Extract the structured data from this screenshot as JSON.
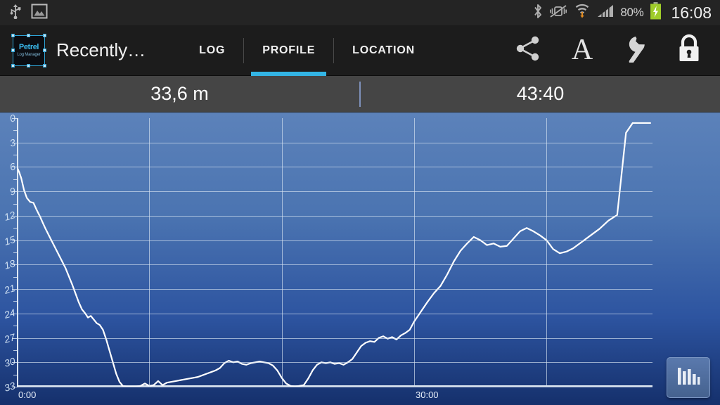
{
  "statusbar": {
    "left_icons": [
      "usb-icon",
      "screenshot-image-icon"
    ],
    "right_icons": [
      "bluetooth-icon",
      "vibrate-mute-icon",
      "wifi-download-icon",
      "cellular-signal-icon"
    ],
    "battery_percent": "80%",
    "battery_state": "charging",
    "clock": "16:08"
  },
  "actionbar": {
    "app_icon_line1": "Petrel",
    "app_icon_line2": "Log Manager",
    "title": "Recently…",
    "tabs": [
      {
        "label": "LOG",
        "active": false
      },
      {
        "label": "PROFILE",
        "active": true
      },
      {
        "label": "LOCATION",
        "active": false
      }
    ],
    "actions": [
      {
        "name": "share-icon",
        "label": "Share"
      },
      {
        "name": "font-icon",
        "label": "A"
      },
      {
        "name": "wrench-icon",
        "label": "Settings"
      },
      {
        "name": "lock-icon",
        "label": "Lock"
      }
    ],
    "accent_color": "#33b5e5"
  },
  "statsbar": {
    "distance": "33,6 m",
    "duration": "43:40"
  },
  "fab": {
    "name": "bar-chart-icon",
    "label": "Statistics"
  },
  "chart_data": {
    "type": "line",
    "title": "",
    "xlabel": "",
    "ylabel": "",
    "y_inverted": true,
    "grid": true,
    "legend": false,
    "line_color": "#ffffff",
    "bg_gradient": [
      "#5c82ba",
      "#15306c"
    ],
    "ylim": [
      0,
      33
    ],
    "ytick_labels": [
      "0",
      "3",
      "6",
      "9",
      "12",
      "15",
      "18",
      "21",
      "24",
      "27",
      "30",
      "33"
    ],
    "ytick_values": [
      0,
      3,
      6,
      9,
      12,
      15,
      18,
      21,
      24,
      27,
      30,
      33
    ],
    "yminor_step": 1.5,
    "xlim": [
      0,
      2880
    ],
    "xtick_labels": [
      "0:00",
      "30:00"
    ],
    "xtick_values": [
      0,
      1800
    ],
    "xgrid_values": [
      0,
      600,
      1200,
      1800,
      2400
    ],
    "x_unit": "seconds (mm:ss)",
    "y_unit": "meters (depth)",
    "series": [
      {
        "name": "Depth profile",
        "x": [
          0,
          10,
          20,
          32,
          45,
          60,
          75,
          90,
          105,
          118,
          130,
          145,
          160,
          175,
          190,
          205,
          220,
          235,
          250,
          265,
          280,
          295,
          310,
          322,
          335,
          350,
          362,
          375,
          390,
          405,
          420,
          435,
          450,
          465,
          480,
          495,
          510,
          525,
          540,
          560,
          580,
          600,
          620,
          640,
          660,
          680,
          700,
          720,
          740,
          760,
          780,
          800,
          820,
          840,
          860,
          880,
          900,
          920,
          940,
          960,
          980,
          1000,
          1020,
          1040,
          1060,
          1080,
          1100,
          1120,
          1140,
          1160,
          1180,
          1200,
          1220,
          1240,
          1260,
          1280,
          1300,
          1320,
          1340,
          1360,
          1380,
          1400,
          1420,
          1440,
          1460,
          1480,
          1500,
          1520,
          1540,
          1560,
          1580,
          1600,
          1620,
          1640,
          1660,
          1680,
          1700,
          1720,
          1740,
          1760,
          1780,
          1800,
          1830,
          1860,
          1890,
          1920,
          1950,
          1980,
          2010,
          2040,
          2070,
          2100,
          2130,
          2160,
          2190,
          2220,
          2250,
          2280,
          2310,
          2340,
          2370,
          2400,
          2430,
          2460,
          2490,
          2520,
          2560,
          2600,
          2640,
          2680,
          2720
        ],
        "y": [
          6.0,
          6.6,
          7.4,
          8.8,
          9.8,
          10.3,
          10.4,
          11.3,
          12.1,
          12.9,
          13.6,
          14.4,
          15.2,
          16.0,
          16.8,
          17.6,
          18.4,
          19.4,
          20.4,
          21.5,
          22.6,
          23.5,
          24.0,
          24.5,
          24.3,
          24.8,
          25.2,
          25.4,
          26.0,
          27.2,
          28.6,
          30.0,
          31.4,
          32.4,
          32.9,
          33.0,
          33.0,
          33.0,
          33.0,
          32.9,
          32.6,
          32.9,
          32.8,
          32.3,
          32.8,
          32.5,
          32.4,
          32.3,
          32.2,
          32.1,
          32.0,
          31.9,
          31.8,
          31.6,
          31.4,
          31.2,
          31.0,
          30.7,
          30.1,
          29.8,
          30.0,
          29.9,
          30.2,
          30.3,
          30.1,
          30.0,
          29.9,
          30.0,
          30.1,
          30.4,
          31.0,
          31.9,
          32.6,
          32.9,
          33.0,
          32.9,
          32.8,
          32.0,
          31.0,
          30.3,
          30.0,
          30.1,
          30.0,
          30.2,
          30.1,
          30.3,
          30.0,
          29.6,
          28.8,
          28.0,
          27.6,
          27.4,
          27.5,
          27.0,
          26.8,
          27.1,
          26.9,
          27.2,
          26.7,
          26.4,
          26.0,
          25.0,
          23.8,
          22.6,
          21.5,
          20.6,
          19.2,
          17.6,
          16.3,
          15.4,
          14.6,
          15.0,
          15.6,
          15.4,
          15.8,
          15.7,
          14.8,
          13.9,
          13.5,
          13.9,
          14.4,
          15.0,
          16.1,
          16.6,
          16.4,
          16.0,
          15.2,
          14.4,
          13.6,
          12.6,
          11.9
        ]
      }
    ],
    "end_flat_value": 0.6
  }
}
